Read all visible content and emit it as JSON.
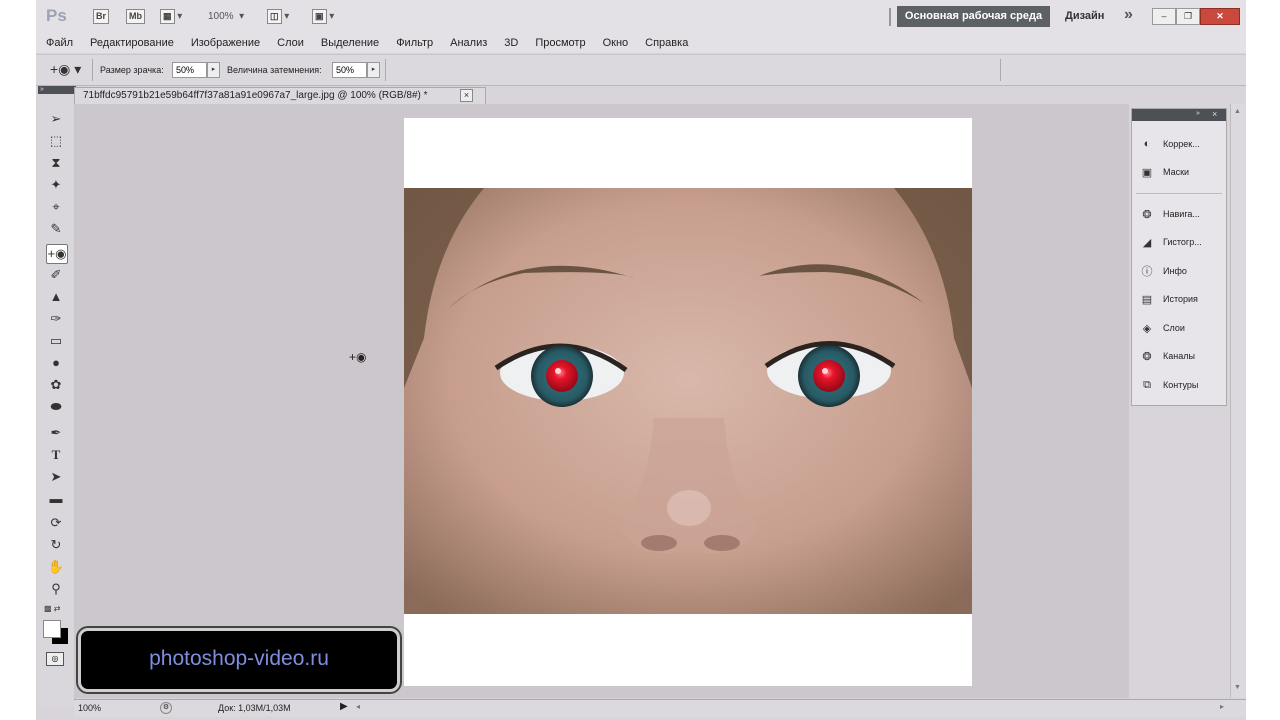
{
  "app": {
    "logo": "Ps",
    "bridge_label": "Br",
    "minibridge_label": "Mb",
    "zoom": "100%",
    "workspace": "Основная рабочая среда",
    "design": "Дизайн",
    "more": "»"
  },
  "menu": [
    "Файл",
    "Редактирование",
    "Изображение",
    "Слои",
    "Выделение",
    "Фильтр",
    "Анализ",
    "3D",
    "Просмотр",
    "Окно",
    "Справка"
  ],
  "options": {
    "pupil_label": "Размер зрачка:",
    "pupil_value": "50%",
    "darken_label": "Величина затемнения:",
    "darken_value": "50%"
  },
  "document": {
    "tab_title": "71bffdc95791b21e59b64ff7f37a81a91e0967a7_large.jpg @ 100% (RGB/8#) *",
    "close": "×"
  },
  "status": {
    "zoom": "100%",
    "doc_info": "Док: 1,03M/1,03M"
  },
  "panels": [
    {
      "label": "Коррек...",
      "icon": "adjustments-icon"
    },
    {
      "label": "Маски",
      "icon": "masks-icon"
    },
    {
      "label": "Навига...",
      "icon": "navigator-icon"
    },
    {
      "label": "Гистогр...",
      "icon": "histogram-icon"
    },
    {
      "label": "Инфо",
      "icon": "info-icon"
    },
    {
      "label": "История",
      "icon": "history-icon"
    },
    {
      "label": "Слои",
      "icon": "layers-icon"
    },
    {
      "label": "Каналы",
      "icon": "channels-icon"
    },
    {
      "label": "Контуры",
      "icon": "paths-icon"
    }
  ],
  "watermark": "photoshop-video.ru",
  "colors": {
    "workspace_bg": "#5d6064",
    "close_button": "#c94a3d",
    "watermark_text": "#7f8dde",
    "red_eye": "#e8142a"
  }
}
